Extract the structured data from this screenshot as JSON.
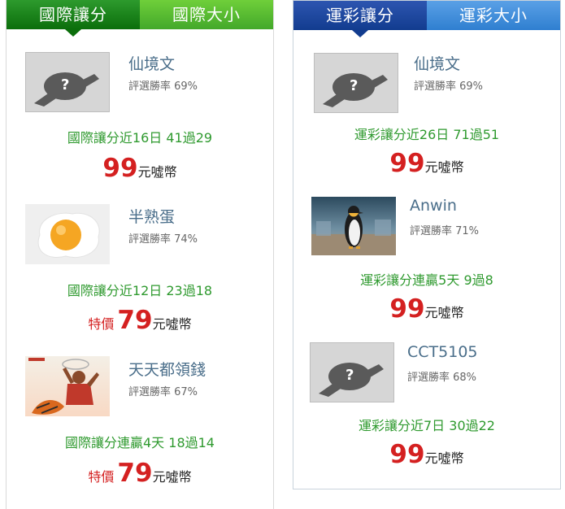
{
  "left": {
    "tabs": [
      {
        "label": "國際讓分",
        "active": true
      },
      {
        "label": "國際大小",
        "active": false
      }
    ],
    "items": [
      {
        "name": "仙境文",
        "win_rate": "評選勝率 69%",
        "stat": "國際讓分近16日 41過29",
        "special": "",
        "price": "99",
        "unit": "元噓幣",
        "avatar": "placeholder-avatar-icon"
      },
      {
        "name": "半熟蛋",
        "win_rate": "評選勝率 74%",
        "stat": "國際讓分近12日 23過18",
        "special": "特價",
        "price": "79",
        "unit": "元噓幣",
        "avatar": "fried-egg-avatar"
      },
      {
        "name": "天天都領錢",
        "win_rate": "評選勝率 67%",
        "stat": "國際讓分連贏4天 18過14",
        "special": "特價",
        "price": "79",
        "unit": "元噓幣",
        "avatar": "basketball-player-avatar"
      }
    ]
  },
  "right": {
    "tabs": [
      {
        "label": "運彩讓分",
        "active": true
      },
      {
        "label": "運彩大小",
        "active": false
      }
    ],
    "items": [
      {
        "name": "仙境文",
        "win_rate": "評選勝率 69%",
        "stat": "運彩讓分近26日 71過51",
        "special": "",
        "price": "99",
        "unit": "元噓幣",
        "avatar": "placeholder-avatar-icon"
      },
      {
        "name": "Anwin",
        "win_rate": "評選勝率 71%",
        "stat": "運彩讓分連贏5天 9過8",
        "special": "",
        "price": "99",
        "unit": "元噓幣",
        "avatar": "penguin-avatar"
      },
      {
        "name": "CCT5105",
        "win_rate": "評選勝率 68%",
        "stat": "運彩讓分近7日 30過22",
        "special": "",
        "price": "99",
        "unit": "元噓幣",
        "avatar": "placeholder-avatar-icon"
      }
    ]
  },
  "colors": {
    "green_tab": "#0b6e0b",
    "blue_tab": "#123c8f",
    "stat_green": "#2f9a2f",
    "price_red": "#d42020",
    "name_blue": "#4a6e8a"
  }
}
